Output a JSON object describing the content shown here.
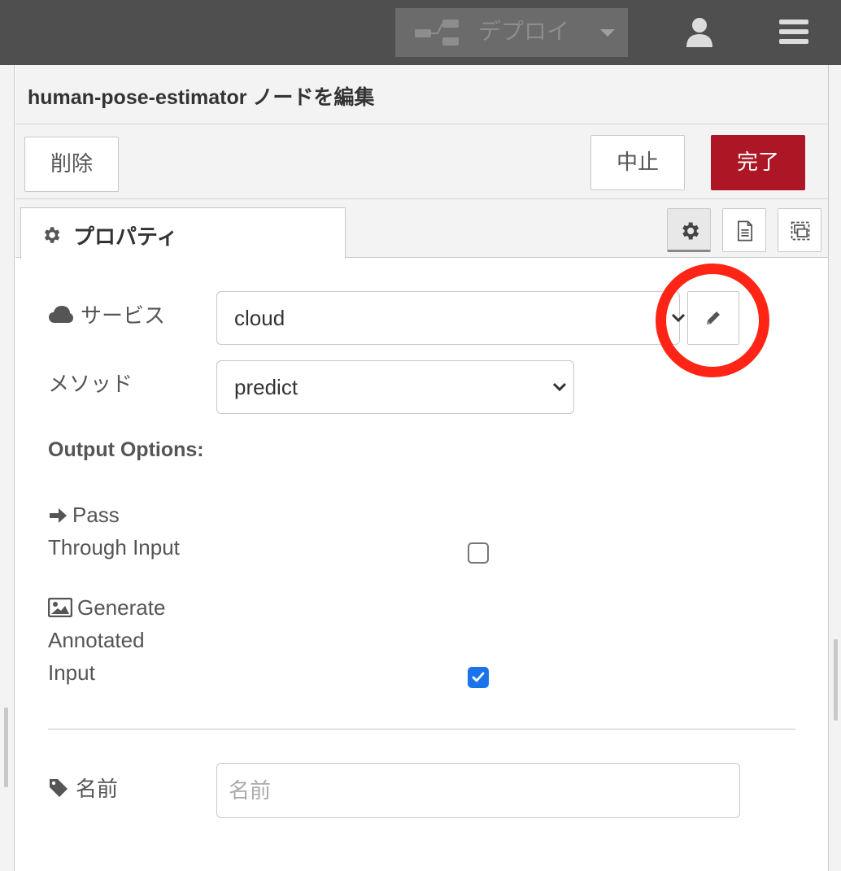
{
  "header": {
    "deploy_label": "デプロイ",
    "deploy_icon": "deploy-flow-icon",
    "user_icon": "user-icon",
    "menu_icon": "hamburger-menu-icon"
  },
  "tray": {
    "title": "human-pose-estimator ノードを編集",
    "delete_label": "削除",
    "cancel_label": "中止",
    "done_label": "完了",
    "done_color": "#ad1625"
  },
  "tabs": {
    "properties_label": "プロパティ",
    "side_buttons": [
      "gear-icon",
      "document-icon",
      "appearance-icon"
    ]
  },
  "form": {
    "service_label": "サービス",
    "service_value": "cloud",
    "method_label": "メソッド",
    "method_value": "predict",
    "output_options_title": "Output Options:",
    "pass_through_line1": "Pass",
    "pass_through_line2": "Through Input",
    "pass_through_checked": false,
    "annotated_line1": "Generate",
    "annotated_line2": "Annotated",
    "annotated_line3": "Input",
    "annotated_checked": true,
    "name_label": "名前",
    "name_placeholder": "名前",
    "name_value": ""
  },
  "annotation": {
    "ring_color": "#ff2516"
  }
}
